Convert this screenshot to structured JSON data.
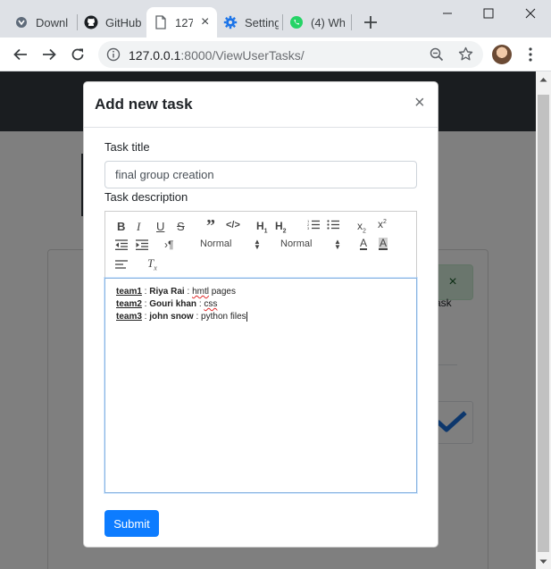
{
  "browser": {
    "tabs": [
      {
        "title": "Downl",
        "icon": "download-favicon"
      },
      {
        "title": "GitHub",
        "icon": "github-favicon"
      },
      {
        "title": "127",
        "icon": "page-favicon",
        "active": true
      },
      {
        "title": "Setting",
        "icon": "settings-favicon"
      },
      {
        "title": "(4) Wh",
        "icon": "whatsapp-favicon"
      }
    ],
    "url_host": "127.0.0.1",
    "url_rest": ":8000/ViewUserTasks/"
  },
  "background": {
    "alert_close": "×",
    "partial_text": "ask"
  },
  "modal": {
    "title": "Add new task",
    "close": "×",
    "task_title_label": "Task title",
    "task_title_value": "final group creation",
    "task_description_label": "Task description",
    "editor_toolbar": {
      "header_select_1": "Normal",
      "header_select_2": "Normal"
    },
    "editor_lines": [
      {
        "team": "team1",
        "sep1": " : ",
        "name": "Riya Rai",
        "sep2": " : ",
        "work": "hmtl",
        "rest": " pages"
      },
      {
        "team": "team2",
        "sep1": " : ",
        "name": "Gouri khan",
        "sep2": " : ",
        "work": "css",
        "rest": ""
      },
      {
        "team": "team3",
        "sep1": " : ",
        "name": "john snow",
        "sep2": " : ",
        "work": "python files",
        "rest": ""
      }
    ],
    "submit_label": "Submit"
  },
  "colors": {
    "primary": "#0d7cff",
    "navbar": "#343a40",
    "alert_bg": "#d4edda",
    "check": "#1a6fd8"
  }
}
